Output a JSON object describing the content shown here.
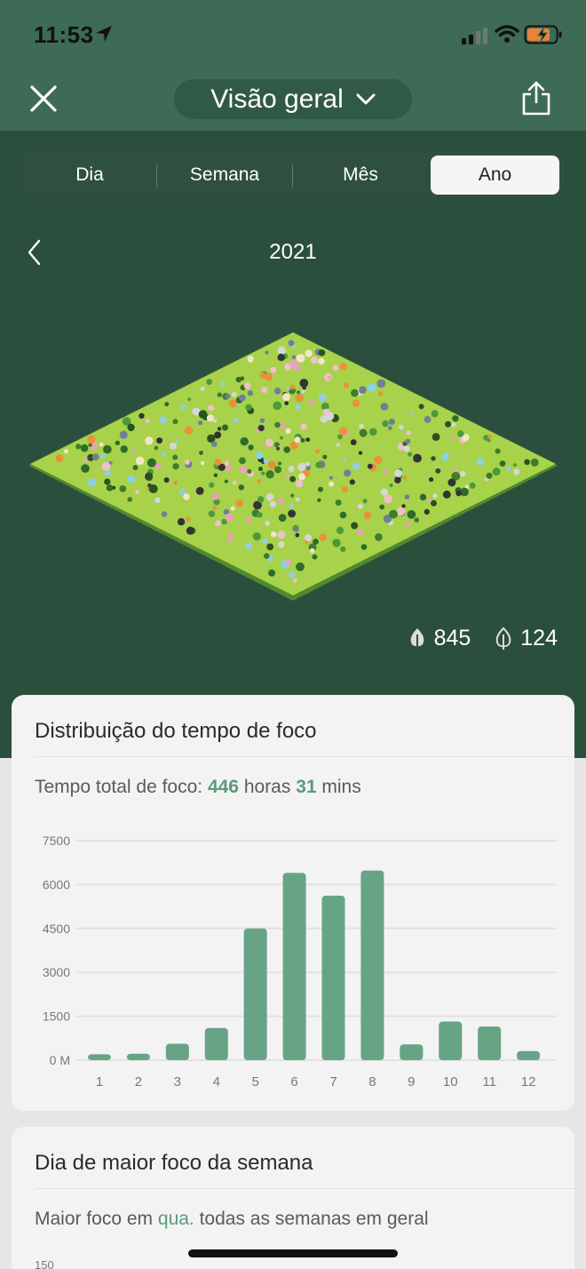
{
  "status_bar": {
    "time": "11:53",
    "icons": [
      "location-arrow-icon",
      "cellular-signal-icon",
      "wifi-icon",
      "battery-charging-icon"
    ]
  },
  "nav": {
    "title": "Visão geral",
    "close_icon": "close-icon",
    "dropdown_icon": "chevron-down-icon",
    "share_icon": "share-icon"
  },
  "period_tabs": {
    "items": [
      "Dia",
      "Semana",
      "Mês",
      "Ano"
    ],
    "selected": "Ano"
  },
  "period": {
    "label": "2021",
    "prev_icon": "chevron-left-icon"
  },
  "forest_stats": {
    "healthy_trees": "845",
    "dead_trees": "124"
  },
  "focus_card": {
    "title": "Distribuição do tempo de foco",
    "total_prefix": "Tempo total de foco: ",
    "total_hours": "446",
    "hours_unit": " horas ",
    "total_mins": "31",
    "mins_unit": " mins"
  },
  "chart_data": {
    "type": "bar",
    "categories": [
      "1",
      "2",
      "3",
      "4",
      "5",
      "6",
      "7",
      "8",
      "9",
      "10",
      "11",
      "12"
    ],
    "values": [
      200,
      220,
      560,
      1100,
      4500,
      6400,
      5620,
      6480,
      540,
      1320,
      1150,
      310
    ],
    "y_tick_labels": [
      "0 M",
      "1500",
      "3000",
      "4500",
      "6000",
      "7500"
    ],
    "y_ticks": [
      0,
      1500,
      3000,
      4500,
      6000,
      7500
    ],
    "ylim": [
      0,
      7500
    ],
    "grid": true,
    "bar_color": "#67a486"
  },
  "weekday_card": {
    "title": "Dia de maior foco da semana",
    "line_prefix": "Maior foco em ",
    "day": "qua.",
    "line_suffix": " todas as semanas em geral",
    "first_tick": "150"
  },
  "colors": {
    "header_green": "#3d6b55",
    "forest_bg": "#2b4f3d",
    "accent": "#5a9a7a",
    "grass": "#a8d24a"
  }
}
